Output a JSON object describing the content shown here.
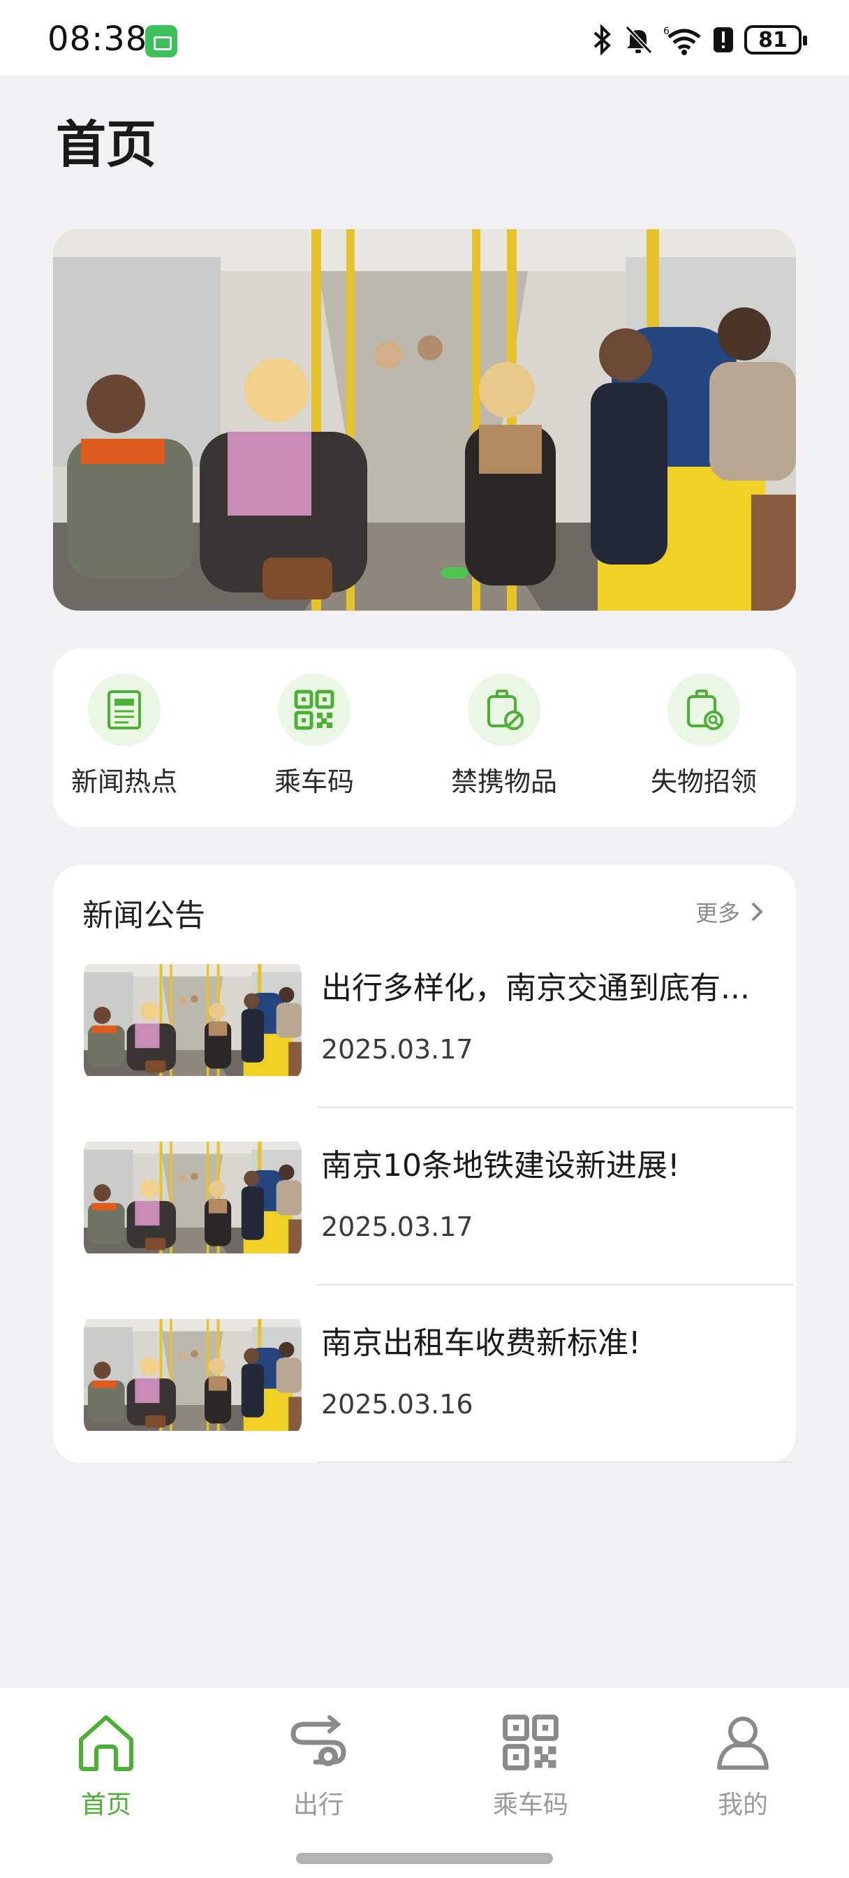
{
  "status_bar": {
    "time": "08:38",
    "battery": "81",
    "icons": [
      "bluetooth-icon",
      "mute-icon",
      "wifi-icon",
      "alert-icon",
      "battery-icon"
    ]
  },
  "page": {
    "title": "首页"
  },
  "banner": {
    "image": "bus-interior-photo",
    "active_slide": 1
  },
  "quick_entries": [
    {
      "label": "新闻热点",
      "icon": "news-icon"
    },
    {
      "label": "乘车码",
      "icon": "qr-code-icon"
    },
    {
      "label": "禁携物品",
      "icon": "prohibited-items-icon"
    },
    {
      "label": "失物招领",
      "icon": "lost-and-found-icon"
    }
  ],
  "news": {
    "title": "新闻公告",
    "more_label": "更多",
    "items": [
      {
        "title": "出行多样化，南京交通到底有...",
        "date": "2025.03.17"
      },
      {
        "title": "南京10条地铁建设新进展!",
        "date": "2025.03.17"
      },
      {
        "title": "南京出租车收费新标准!",
        "date": "2025.03.16"
      }
    ]
  },
  "tabs": [
    {
      "label": "首页",
      "icon": "home-icon",
      "active": true
    },
    {
      "label": "出行",
      "icon": "route-icon",
      "active": false
    },
    {
      "label": "乘车码",
      "icon": "qr-code-icon",
      "active": false
    },
    {
      "label": "我的",
      "icon": "user-icon",
      "active": false
    }
  ],
  "colors": {
    "accent": "#4cb034",
    "accent_light": "#e9f7e4",
    "background": "#f1f1f3",
    "inactive": "#9a9a9a"
  }
}
